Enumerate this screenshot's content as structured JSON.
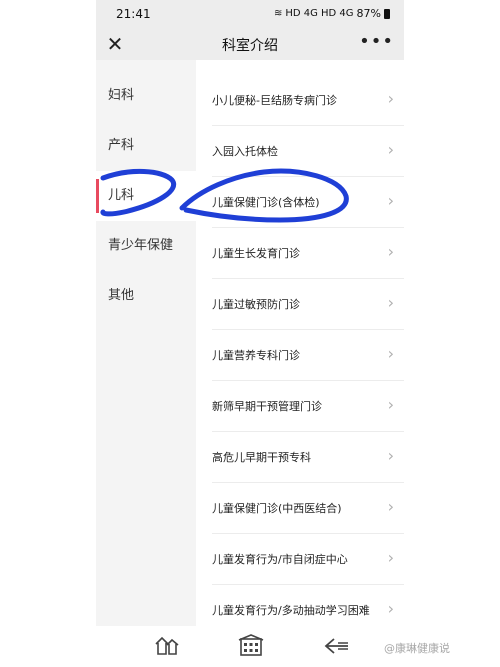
{
  "status_bar": {
    "time": "21:41",
    "network": "HD 4G HD 4G",
    "battery": "87%"
  },
  "nav": {
    "title": "科室介绍",
    "close_icon": "close-icon",
    "more_icon": "more-icon"
  },
  "sidebar": {
    "items": [
      {
        "label": "妇科",
        "active": false
      },
      {
        "label": "产科",
        "active": false
      },
      {
        "label": "儿科",
        "active": true
      },
      {
        "label": "青少年保健",
        "active": false
      },
      {
        "label": "其他",
        "active": false
      }
    ]
  },
  "departments": [
    {
      "label": "小儿便秘-巨结肠专病门诊"
    },
    {
      "label": "入园入托体检"
    },
    {
      "label": "儿童保健门诊(含体检)"
    },
    {
      "label": "儿童生长发育门诊"
    },
    {
      "label": "儿童过敏预防门诊"
    },
    {
      "label": "儿童营养专科门诊"
    },
    {
      "label": "新筛早期干预管理门诊"
    },
    {
      "label": "高危儿早期干预专科"
    },
    {
      "label": "儿童保健门诊(中西医结合)"
    },
    {
      "label": "儿童发育行为/市自闭症中心"
    },
    {
      "label": "儿童发育行为/多动抽动学习困难"
    }
  ],
  "tab_bar": {
    "icons": [
      "tab-home-icon",
      "tab-building-icon",
      "tab-back-icon"
    ]
  },
  "watermark": "@康琳健康说",
  "colors": {
    "accent": "#e84a5f",
    "annotation": "#1f3fd6"
  }
}
